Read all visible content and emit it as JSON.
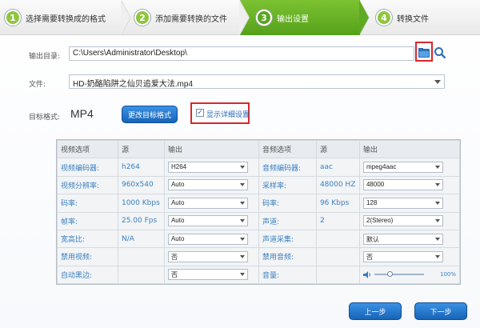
{
  "steps": [
    {
      "num": "1",
      "label": "选择需要转换成的格式",
      "active": false
    },
    {
      "num": "2",
      "label": "添加需要转换的文件",
      "active": false
    },
    {
      "num": "3",
      "label": "输出设置",
      "active": true
    },
    {
      "num": "4",
      "label": "转换文件",
      "active": false
    }
  ],
  "output": {
    "label": "输出目录:",
    "path": "C:\\Users\\Administrator\\Desktop\\"
  },
  "file": {
    "label": "文件:",
    "value": "HD-奶酪陷阱之仙贝追爱大法.mp4"
  },
  "target": {
    "label": "目标格式:",
    "format": "MP4",
    "change_button": "更改目标格式",
    "show_details_label": "显示详细设置",
    "show_details_checked": true
  },
  "table": {
    "headers": [
      "视频选项",
      "源",
      "输出",
      "音频选项",
      "源",
      "输出"
    ],
    "rows": [
      {
        "vlabel": "视频编码器:",
        "vsrc": "h264",
        "vout": "H264",
        "alabel": "音频编码器:",
        "asrc": "aac",
        "aout": "mpeg4aac"
      },
      {
        "vlabel": "视频分辨率:",
        "vsrc": "960x540",
        "vout": "Auto",
        "alabel": "采样率:",
        "asrc": "48000 HZ",
        "aout": "48000"
      },
      {
        "vlabel": "码率:",
        "vsrc": "1000 Kbps",
        "vout": "Auto",
        "alabel": "码率:",
        "asrc": "96 Kbps",
        "aout": "128"
      },
      {
        "vlabel": "帧率:",
        "vsrc": "25.00 Fps",
        "vout": "Auto",
        "alabel": "声道:",
        "asrc": "2",
        "aout": "2(Stereo)"
      },
      {
        "vlabel": "宽高比:",
        "vsrc": "N/A",
        "vout": "Auto",
        "alabel": "声道采集:",
        "asrc": "",
        "aout": "默认"
      },
      {
        "vlabel": "禁用视频:",
        "vsrc": "",
        "vout": "否",
        "alabel": "禁用音频:",
        "asrc": "",
        "aout": "否"
      },
      {
        "vlabel": "自动黑边:",
        "vsrc": "",
        "vout": "否",
        "alabel": "音量:",
        "asrc": "",
        "aout": ""
      }
    ],
    "volume_percent": "100%"
  },
  "buttons": {
    "prev": "上一步",
    "next": "下一步"
  },
  "colors": {
    "accent": "#5aa61d",
    "button": "#1664b8",
    "highlight": "#d9262b"
  }
}
